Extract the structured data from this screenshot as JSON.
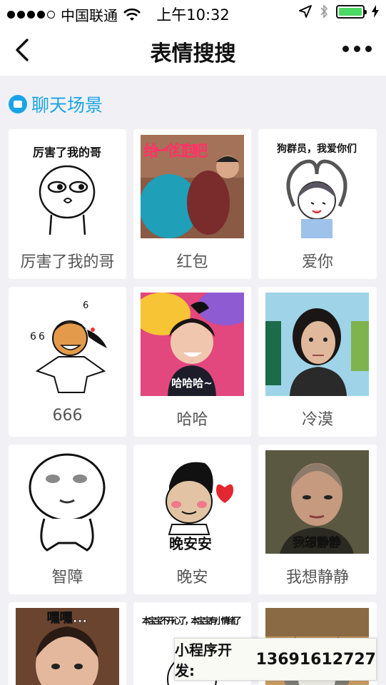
{
  "statusbar": {
    "carrier": "中国联通",
    "time": "上午10:32"
  },
  "navbar": {
    "title": "表情搜搜"
  },
  "section": {
    "title": "聊天场景",
    "icon": "chat-bubble-icon"
  },
  "grid": [
    {
      "label": "厉害了我的哥",
      "caption": "厉害了我的哥"
    },
    {
      "label": "红包",
      "caption": "给一个红包吧"
    },
    {
      "label": "爱你",
      "caption": "狗群员，我爱你们"
    },
    {
      "label": "666",
      "caption": ""
    },
    {
      "label": "哈哈",
      "caption": "哈哈哈~"
    },
    {
      "label": "冷漠",
      "caption": ""
    },
    {
      "label": "智障",
      "caption": ""
    },
    {
      "label": "晚安",
      "caption": "晚安安"
    },
    {
      "label": "我想静静",
      "caption": "我想静静"
    },
    {
      "label": "",
      "caption": "嘿嘿..."
    },
    {
      "label": "",
      "caption": "本宝宝不开心了，本宝宝有小情绪了"
    },
    {
      "label": "",
      "caption": ""
    }
  ],
  "watermark": {
    "prefix": "小程序开发:",
    "number": "13691612727"
  },
  "colors": {
    "accent": "#1aa4e8",
    "background": "#f1f1f5",
    "battery": "#4cd964"
  }
}
